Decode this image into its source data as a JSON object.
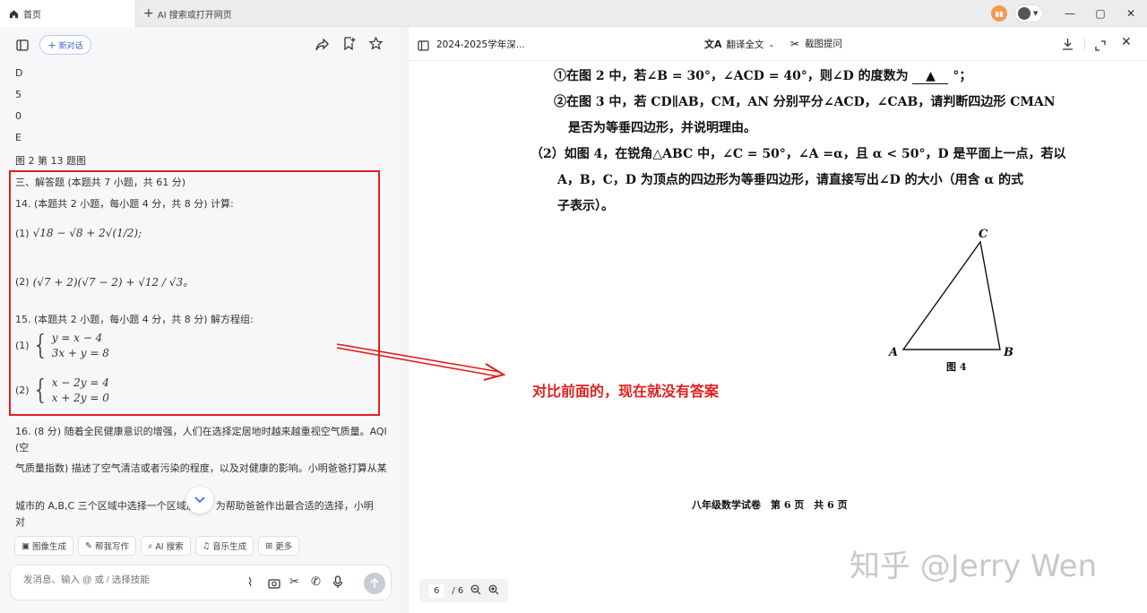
{
  "tabs": {
    "home": "首页",
    "new_tab": "AI 搜索或打开网页"
  },
  "window_controls": [
    "—",
    "▢",
    "✕"
  ],
  "left": {
    "new_chat": "新对话",
    "lines": [
      "D",
      "5",
      "0",
      "E",
      "图 2 第 13 题图",
      "三、解答题 (本题共 7 小题，共 61 分)",
      "14. (本题共 2 小题，每小题 4 分，共 8 分) 计算:",
      "15. (本题共 2 小题，每小题 4 分，共 8 分) 解方程组:",
      "16. (8 分) 随着全民健康意识的增强，人们在选择定居地时越来越重视空气质量。AQI (空",
      "气质量指数) 描述了空气清洁或者污染的程度，以及对健康的影响。小明爸爸打算从某",
      "城市的 A,B,C 三个区域中选择一个区域居住，为帮助爸爸作出最合适的选择，小明对"
    ],
    "math": {
      "p1_label": "(1)",
      "p1": "√18 − √8 + 2√(1/2);",
      "p2_label": "(2)",
      "p2": "(√7 + 2)(√7 − 2) + √12 / √3。",
      "s1_label": "(1)",
      "s1a": "y = x − 4",
      "s1b": "3x + y = 8",
      "s2_label": "(2)",
      "s2a": "x − 2y = 4",
      "s2b": "x + 2y = 0"
    },
    "chips": [
      "图像生成",
      "帮我写作",
      "AI 搜索",
      "音乐生成",
      "更多"
    ],
    "input_placeholder": "发消息、输入 @ 或 / 选择技能"
  },
  "right": {
    "doc_title": "2024-2025学年深...",
    "translate": "翻译全文",
    "screenshot_ask": "截图提问",
    "q1": "①在图 2 中，若∠B = 30°，∠ACD = 40°，则∠D 的度数为",
    "q1_blank": "▲",
    "q1_end": "°；",
    "q2a": "②在图 3 中，若 CD∥AB，CM，AN 分别平分∠ACD，∠CAB，请判断四边形 CMAN",
    "q2b": "是否为等垂四边形，并说明理由。",
    "q3a": "（2）如图 4，在锐角△ABC 中，∠C = 50°，∠A =α，且 α < 50°，D 是平面上一点，若以",
    "q3b": "A，B，C，D 为顶点的四边形为等垂四边形，请直接写出∠D 的大小（用含 α 的式",
    "q3c": "子表示）。",
    "fig_label": "图 4",
    "pt_a": "A",
    "pt_b": "B",
    "pt_c": "C",
    "annotation": "对比前面的，现在就没有答案",
    "footer": "八年级数学试卷　第 6 页　共 6 页",
    "watermark": "知乎 @Jerry Wen",
    "page_current": "6",
    "page_total": "/ 6"
  }
}
